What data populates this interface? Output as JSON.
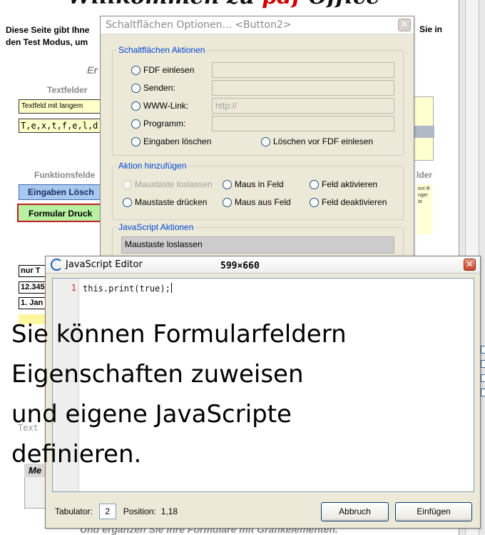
{
  "background_page": {
    "title_start": "Willkommen zu ",
    "title_pdf": "pdf",
    "title_end": " Office",
    "intro_left": "Diese Seite gibt Ihne den Test Modus, um",
    "intro_right": "Sie in",
    "er": "Er",
    "textfelder": "Textfelder",
    "field1": "Textfeld mit langem",
    "field2": "T,e,x,t,f,e,l,d",
    "funktionsfelder": "Funktionsfelde",
    "clear_button": "Eingaben Lösch",
    "print_button": "Formular Druck",
    "small_fields": [
      "nur T",
      "12.345",
      "1. Jan"
    ],
    "text_label": "Text",
    "table_header": "Me",
    "right_header": "lder",
    "right_note": "ext ift nger ar",
    "footer": "Und ergänzen Sie Ihre Formulare mit Grafikelementen."
  },
  "button_options": {
    "title": "Schaltflächen Optionen... <Button2>",
    "close": "✕",
    "actions_group": "Schaltflächen Aktionen",
    "actions": [
      {
        "label": "FDF einlesen",
        "value": ""
      },
      {
        "label": "Senden:",
        "value": ""
      },
      {
        "label": "WWW-Link:",
        "value": "http://"
      },
      {
        "label": "Programm:",
        "value": ""
      }
    ],
    "clear_inputs": "Eingaben löschen",
    "clear_before_fdf": "Löschen vor FDF einlesen",
    "add_action_group": "Aktion hinzufügen",
    "triggers": [
      "Maustaste loslassen",
      "Maus in Feld",
      "Feld aktivieren",
      "Maustaste drücken",
      "Maus aus Feld",
      "Feld deaktivieren"
    ],
    "js_group": "JavaScript Aktionen",
    "js_list_item": "Maustaste loslassen"
  },
  "js_editor": {
    "title": "JavaScript Editor",
    "size_label": "599×660",
    "close": "✕",
    "line_number": "1",
    "code": "this.print(true);",
    "tab_label": "Tabulator:",
    "tab_value": "2",
    "position_label": "Position:",
    "position_value": "1,18",
    "cancel": "Abbruch",
    "insert": "Einfügen"
  },
  "caption": {
    "lines": [
      "Sie können Formularfeldern",
      "Eigenschaften zuweisen",
      "und eigene JavaScripte",
      "definieren."
    ]
  }
}
